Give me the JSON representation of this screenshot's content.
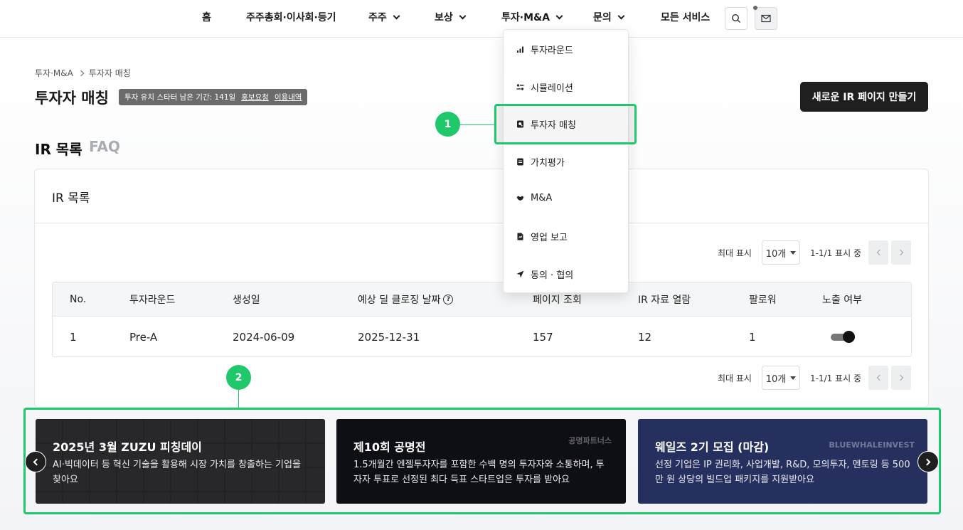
{
  "nav": {
    "items": [
      {
        "label": "홈",
        "dropdown": false
      },
      {
        "label": "주주총회·이사회·등기",
        "dropdown": false
      },
      {
        "label": "주주",
        "dropdown": true
      },
      {
        "label": "보상",
        "dropdown": true
      },
      {
        "label": "투자·M&A",
        "dropdown": true
      },
      {
        "label": "문의",
        "dropdown": true
      },
      {
        "label": "모든 서비스",
        "dropdown": false
      }
    ],
    "search_icon": "search-icon",
    "mail_icon": "mail-icon"
  },
  "breadcrumb": [
    "투자·M&A",
    "투자자 매칭"
  ],
  "page": {
    "title": "투자자 매칭",
    "badge_text": "투자 유치 스타터 남은 기간: 141일",
    "badge_link1": "홍보요청",
    "badge_link2": "이용내역",
    "new_ir_button": "새로운 IR 페이지 만들기"
  },
  "tabs": [
    {
      "label": "IR 목록",
      "active": true
    },
    {
      "label": "FAQ",
      "active": false
    }
  ],
  "ir_card": {
    "title": "IR 목록",
    "pager": {
      "label": "최대 표시",
      "page_size": "10개",
      "range": "1-1/1 표시 중"
    },
    "columns": [
      "No.",
      "투자라운드",
      "생성일",
      "예상 딜 클로징 날짜",
      "페이지 조회",
      "IR 자료 열람",
      "팔로워",
      "노출 여부"
    ],
    "help_icon": "?",
    "rows": [
      {
        "no": "1",
        "round": "Pre-A",
        "created": "2024-06-09",
        "closing": "2025-12-31",
        "views": "157",
        "ir_views": "12",
        "followers": "1",
        "exposed": true
      }
    ]
  },
  "dropdown_menu": {
    "items": [
      {
        "label": "투자라운드",
        "icon": "bar-chart-icon"
      },
      {
        "label": "시뮬레이션",
        "icon": "sliders-icon"
      },
      {
        "label": "투자자 매칭",
        "icon": "search-doc-icon"
      },
      {
        "label": "가치평가",
        "icon": "document-icon"
      },
      {
        "label": "M&A",
        "icon": "handshake-icon"
      },
      {
        "label": "영업 보고",
        "icon": "report-icon"
      },
      {
        "label": "동의 · 협의",
        "icon": "send-icon"
      }
    ]
  },
  "markers": [
    "1",
    "2"
  ],
  "banners": [
    {
      "title": "2025년 3월 ZUZU 피칭데이",
      "desc": "AI·빅데이터 등 혁신 기술을 활용해 시장 가치를 창출하는 기업을 찾아요",
      "bg": "#2b2b2d",
      "brand": ""
    },
    {
      "title": "제10회 공명전",
      "desc": "1.5개월간 엔젤투자자를 포함한 수백 명의 투자자와 소통하며, 투자자 투표로 선정된 최다 득표 스타트업은 투자를 받아요",
      "bg": "#0e0f14",
      "brand": "공명파트너스"
    },
    {
      "title": "웨일즈 2기 모집 (마감)",
      "desc": "선정 기업은 IP 권리화, 사업개발, R&D, 모의투자, 멘토링 등 500만 원 상당의 빌드업 패키지를 지원받아요",
      "bg": "#26305e",
      "brand": "BLUEWHALEINVEST"
    }
  ],
  "colors": {
    "accent": "#1fc86b",
    "dark": "#1f1f1f"
  }
}
